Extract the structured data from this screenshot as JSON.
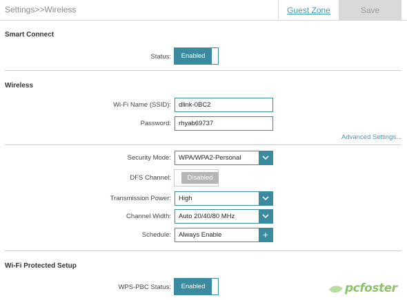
{
  "header": {
    "breadcrumb": "Settings>>Wireless",
    "guest_zone_tab": "Guest Zone",
    "save_label": "Save"
  },
  "smart_connect": {
    "title": "Smart Connect",
    "status_label": "Status:",
    "status_value": "Enabled"
  },
  "wireless": {
    "title": "Wireless",
    "ssid_label": "Wi-Fi Name (SSID):",
    "ssid_value": "dlink-0BC2",
    "password_label": "Password:",
    "password_value": "rhyab69737",
    "advanced_link": "Advanced Settings...",
    "security_mode_label": "Security Mode:",
    "security_mode_value": "WPA/WPA2-Personal",
    "dfs_label": "DFS Channel:",
    "dfs_value": "Disabled",
    "tx_power_label": "Transmission Power:",
    "tx_power_value": "High",
    "channel_width_label": "Channel Width:",
    "channel_width_value": "Auto 20/40/80 MHz",
    "schedule_label": "Schedule:",
    "schedule_value": "Always Enable"
  },
  "wps": {
    "title": "Wi-Fi Protected Setup",
    "status_label": "WPS-PBC Status:",
    "status_value": "Enabled"
  },
  "watermark": {
    "text": "pcfoster"
  },
  "colors": {
    "accent": "#3a8ba0",
    "link": "#3f9bb0",
    "disabled": "#b5b5b5",
    "watermark": "#8ac46a"
  }
}
